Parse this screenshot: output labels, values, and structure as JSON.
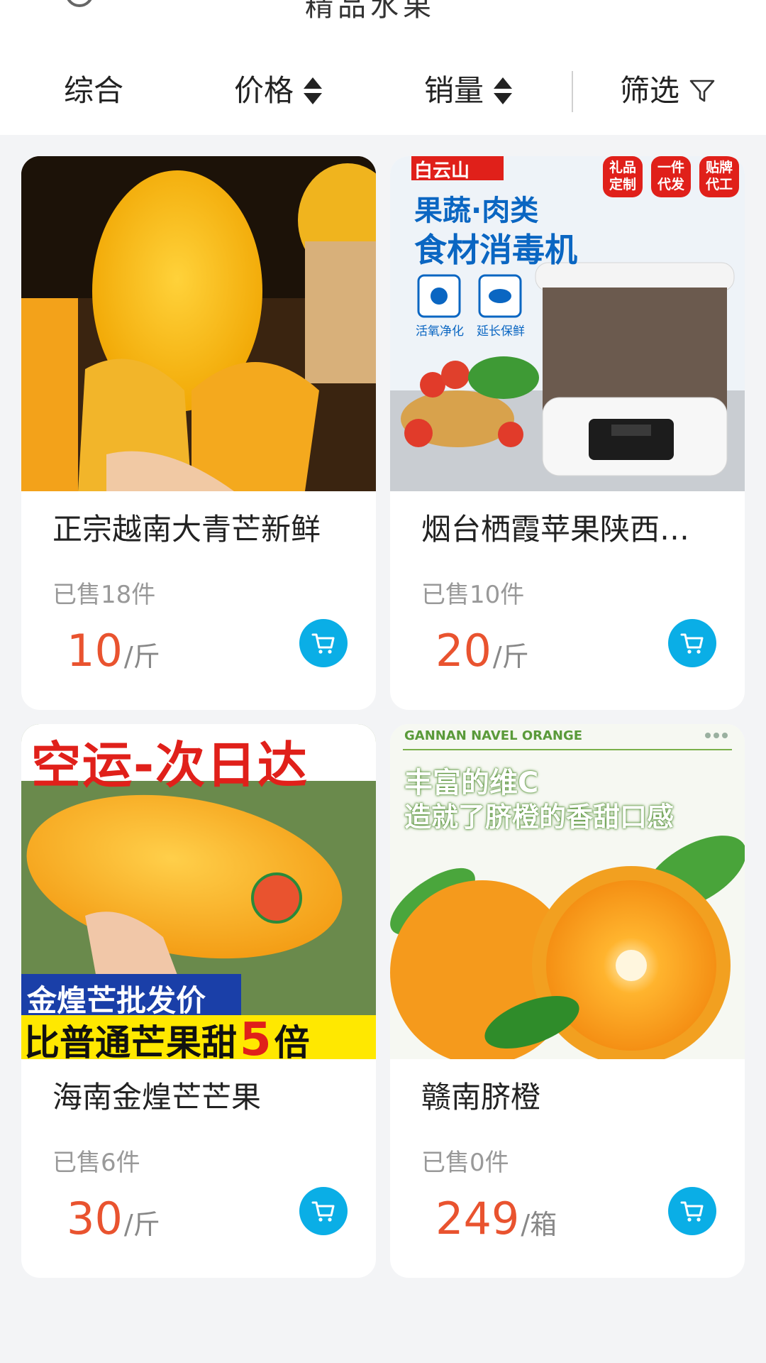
{
  "header": {
    "title": "精品水果"
  },
  "sortbar": {
    "comprehensive": "综合",
    "price": "价格",
    "sales": "销量",
    "filter": "筛选"
  },
  "products": [
    {
      "name": "正宗越南大青芒新鲜",
      "sold": "已售18件",
      "price": "10",
      "unit": "/斤"
    },
    {
      "name": "烟台栖霞苹果陕西…",
      "sold": "已售10件",
      "price": "20",
      "unit": "/斤",
      "image_text": {
        "brand": "白云山",
        "line1": "果蔬·肉类",
        "line2": "食材消毒机",
        "feature1": "活氧净化",
        "feature2": "延长保鲜",
        "badge1": "礼品定制",
        "badge2": "一件代发",
        "badge3": "贴牌代工"
      }
    },
    {
      "name": "海南金煌芒芒果",
      "sold": "已售6件",
      "price": "30",
      "unit": "/斤",
      "image_text": {
        "top": "空运-次日达",
        "banner1": "金煌芒批发价",
        "banner2": "比普通芒果甜",
        "banner_num": "5",
        "banner_suffix": "倍"
      }
    },
    {
      "name": "赣南脐橙",
      "sold": "已售0件",
      "price": "249",
      "unit": "/箱",
      "image_text": {
        "en": "GANNAN NAVEL ORANGE",
        "line1": "丰富的维C",
        "line2": "造就了脐橙的香甜口感"
      }
    }
  ],
  "colors": {
    "price": "#e9532f",
    "cart": "#0aaee6",
    "background": "#f3f4f6"
  },
  "icons": [
    "sort-arrows-icon",
    "filter-funnel-icon",
    "cart-icon"
  ]
}
